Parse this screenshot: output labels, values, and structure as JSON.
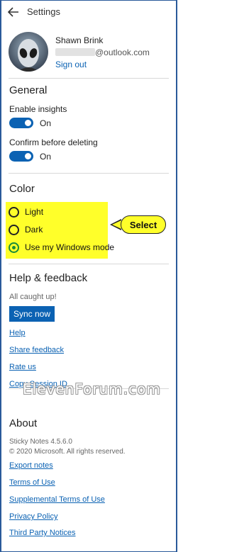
{
  "window": {
    "title": "Settings"
  },
  "account": {
    "name": "Shawn Brink",
    "email": "@outlook.com",
    "sign_out": "Sign out"
  },
  "general": {
    "heading": "General",
    "insights_label": "Enable insights",
    "insights_state": "On",
    "confirm_label": "Confirm before deleting",
    "confirm_state": "On"
  },
  "color": {
    "heading": "Color",
    "options": [
      "Light",
      "Dark",
      "Use my Windows mode"
    ],
    "selected": "Use my Windows mode",
    "callout": "Select",
    "highlight_color": "#ffff2a"
  },
  "help": {
    "heading": "Help & feedback",
    "status": "All caught up!",
    "sync_button": "Sync now",
    "links": [
      "Help",
      "Share feedback",
      "Rate us",
      "Copy Session ID"
    ]
  },
  "watermark": "ElevenForum.com",
  "about": {
    "heading": "About",
    "version": "Sticky Notes 4.5.6.0",
    "copyright": "© 2020 Microsoft. All rights reserved.",
    "links": [
      "Export notes",
      "Terms of Use",
      "Supplemental Terms of Use",
      "Privacy Policy",
      "Third Party Notices"
    ]
  },
  "colors": {
    "accent": "#0b62b3",
    "selected_radio": "#1a8a3a"
  }
}
